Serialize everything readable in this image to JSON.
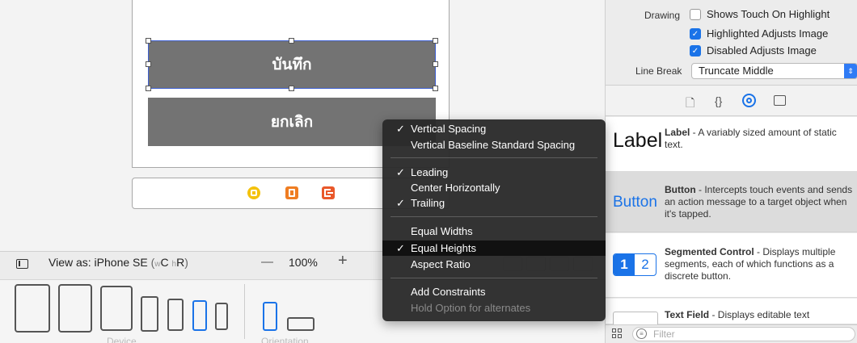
{
  "scene": {
    "save_button_label": "บันทึก",
    "cancel_button_label": "ยกเลิก"
  },
  "view_as": {
    "label": "View as: iPhone SE",
    "size_class_w_prefix": "w",
    "size_class_w": "C",
    "size_class_h_prefix": "h",
    "size_class_h": "R",
    "zoom_minus": "—",
    "zoom_level": "100%",
    "zoom_plus": "+"
  },
  "devices_bar": {
    "device_label": "Device",
    "orientation_label": "Orientation"
  },
  "inspector": {
    "drawing_label": "Drawing",
    "shows_touch_label": "Shows Touch On Highlight",
    "highlighted_adjusts_label": "Highlighted Adjusts Image",
    "disabled_adjusts_label": "Disabled Adjusts Image",
    "shows_touch_checked": false,
    "highlighted_adjusts_checked": true,
    "disabled_adjusts_checked": true,
    "line_break_label": "Line Break",
    "line_break_value": "Truncate Middle"
  },
  "library": {
    "items": [
      {
        "preview": "Label",
        "title": "Label",
        "desc": " - A variably sized amount of static text."
      },
      {
        "preview": "Button",
        "title": "Button",
        "desc": " - Intercepts touch events and sends an action message to a target object when it's tapped."
      },
      {
        "preview_1": "1",
        "preview_2": "2",
        "title": "Segmented Control",
        "desc": " - Displays multiple segments, each of which functions as a discrete button."
      },
      {
        "title": "Text Field",
        "desc": " - Displays editable text"
      }
    ],
    "filter_placeholder": "Filter"
  },
  "constraint_menu": {
    "items": [
      {
        "label": "Vertical Spacing",
        "checked": true
      },
      {
        "label": "Vertical Baseline Standard Spacing",
        "checked": false
      },
      {
        "label": "Leading",
        "checked": true
      },
      {
        "label": "Center Horizontally",
        "checked": false
      },
      {
        "label": "Trailing",
        "checked": true
      },
      {
        "label": "Equal Widths",
        "checked": false
      },
      {
        "label": "Equal Heights",
        "checked": true
      },
      {
        "label": "Aspect Ratio",
        "checked": false
      },
      {
        "label": "Add Constraints",
        "checked": false
      },
      {
        "label": "Hold Option for alternates",
        "checked": false,
        "disabled": true
      }
    ],
    "check_glyph": "✓"
  },
  "colors": {
    "selection_blue": "#3d5ecf",
    "accent_blue": "#1a73e8",
    "button_gray": "#737373",
    "menu_bg": "#282828"
  }
}
